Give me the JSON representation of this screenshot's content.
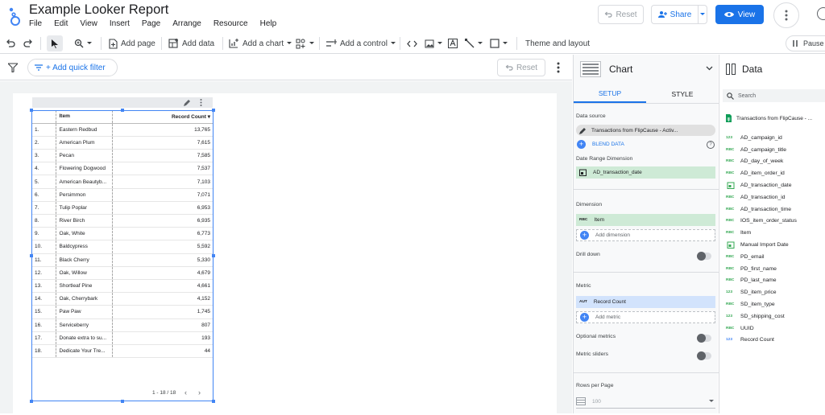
{
  "app": {
    "title": "Example Looker Report",
    "menu": [
      "File",
      "Edit",
      "View",
      "Insert",
      "Page",
      "Arrange",
      "Resource",
      "Help"
    ],
    "reset_label": "Reset",
    "share_label": "Share",
    "view_label": "View"
  },
  "toolbar": {
    "add_page": "Add page",
    "add_data": "Add data",
    "add_chart": "Add a chart",
    "add_control": "Add a control",
    "theme_layout": "Theme and layout",
    "pause": "Pause"
  },
  "filterbar": {
    "quick_filter": "+ Add quick filter",
    "reset": "Reset"
  },
  "table": {
    "col_item": "Item",
    "col_count": "Record Count",
    "rows": [
      [
        "1.",
        "Eastern Redbud",
        "13,765"
      ],
      [
        "2.",
        "American Plum",
        "7,615"
      ],
      [
        "3.",
        "Pecan",
        "7,585"
      ],
      [
        "4.",
        "Flowering Dogwood",
        "7,537"
      ],
      [
        "5.",
        "American Beautyb...",
        "7,103"
      ],
      [
        "6.",
        "Persimmon",
        "7,071"
      ],
      [
        "7.",
        "Tulip Poplar",
        "6,953"
      ],
      [
        "8.",
        "River Birch",
        "6,935"
      ],
      [
        "9.",
        "Oak, White",
        "6,773"
      ],
      [
        "10.",
        "Baldcypress",
        "5,592"
      ],
      [
        "11.",
        "Black Cherry",
        "5,330"
      ],
      [
        "12.",
        "Oak, Willow",
        "4,679"
      ],
      [
        "13.",
        "Shortleaf Pine",
        "4,661"
      ],
      [
        "14.",
        "Oak, Cherrybark",
        "4,152"
      ],
      [
        "15.",
        "Paw Paw",
        "1,745"
      ],
      [
        "16.",
        "Serviceberry",
        "807"
      ],
      [
        "17.",
        "Donate extra to su...",
        "193"
      ],
      [
        "18.",
        "Dedicate Your Tre...",
        "44"
      ]
    ],
    "pagination": "1 - 18 / 18"
  },
  "chart_panel": {
    "title": "Chart",
    "tab_setup": "SETUP",
    "tab_style": "STYLE",
    "data_source_label": "Data source",
    "data_source": "Transactions from FlipCause - Activ...",
    "blend_data": "BLEND DATA",
    "date_range_label": "Date Range Dimension",
    "date_range_field": "AD_transaction_date",
    "dimension_label": "Dimension",
    "dimension_field": "Item",
    "add_dimension": "Add dimension",
    "drill_down": "Drill down",
    "metric_label": "Metric",
    "metric_field": "Record Count",
    "metric_type": "AUT",
    "add_metric": "Add metric",
    "optional_metrics": "Optional metrics",
    "metric_sliders": "Metric sliders",
    "rows_per_page_label": "Rows per Page",
    "rows_per_page": "100"
  },
  "data_panel": {
    "title": "Data",
    "search_placeholder": "Search",
    "source": "Transactions from FlipCause - ...",
    "fields": [
      {
        "type": "123",
        "name": "AD_campaign_id"
      },
      {
        "type": "RBC",
        "name": "AD_campaign_title"
      },
      {
        "type": "RBC",
        "name": "AD_day_of_week"
      },
      {
        "type": "RBC",
        "name": "AD_item_order_id"
      },
      {
        "type": "date",
        "name": "AD_transaction_date"
      },
      {
        "type": "RBC",
        "name": "AD_transaction_id"
      },
      {
        "type": "RBC",
        "name": "AD_transaction_time"
      },
      {
        "type": "RBC",
        "name": "IOS_item_order_status"
      },
      {
        "type": "RBC",
        "name": "Item"
      },
      {
        "type": "date",
        "name": "Manual Import Date"
      },
      {
        "type": "RBC",
        "name": "PD_email"
      },
      {
        "type": "RBC",
        "name": "PD_first_name"
      },
      {
        "type": "RBC",
        "name": "PD_last_name"
      },
      {
        "type": "123",
        "name": "SD_item_price"
      },
      {
        "type": "RBC",
        "name": "SD_item_type"
      },
      {
        "type": "123",
        "name": "SD_shipping_cost"
      },
      {
        "type": "RBC",
        "name": "UUID"
      },
      {
        "type": "123b",
        "name": "Record Count"
      }
    ]
  },
  "colors": {
    "accent": "#1a73e8",
    "selection": "#4285f4",
    "green_field": "#ceead6",
    "blue_field": "#d2e3fc"
  }
}
